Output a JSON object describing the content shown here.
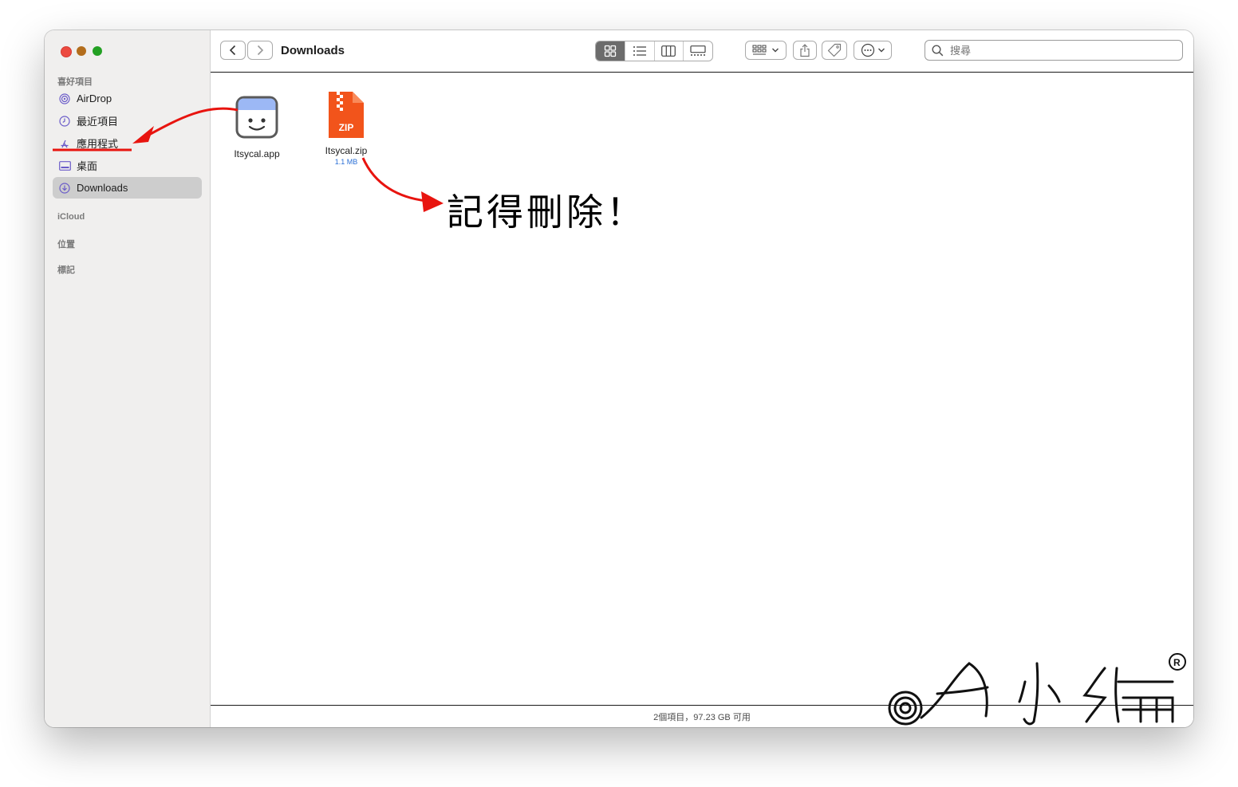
{
  "window": {
    "title": "Downloads"
  },
  "sidebar": {
    "favorites_header": "喜好項目",
    "items": [
      {
        "label": "AirDrop",
        "icon": "airdrop-icon"
      },
      {
        "label": "最近項目",
        "icon": "clock-icon"
      },
      {
        "label": "應用程式",
        "icon": "applications-icon"
      },
      {
        "label": "桌面",
        "icon": "desktop-icon"
      },
      {
        "label": "Downloads",
        "icon": "downloads-icon",
        "selected": true
      }
    ],
    "icloud_header": "iCloud",
    "locations_header": "位置",
    "tags_header": "標記"
  },
  "toolbar": {
    "search_placeholder": "搜尋",
    "view_modes": [
      "icon",
      "list",
      "column",
      "gallery"
    ],
    "active_view": "icon"
  },
  "files": [
    {
      "name": "Itsycal.app",
      "icon": "itsycal-app-icon"
    },
    {
      "name": "Itsycal.zip",
      "size": "1.1 MB",
      "icon": "zip-archive-icon",
      "badge": "ZIP"
    }
  ],
  "status": {
    "text": "2個項目，97.23 GB 可用"
  },
  "annotation": {
    "text": "記得刪除！",
    "color": "#e8140f"
  },
  "watermark": {
    "text": "A小編"
  },
  "colors": {
    "selected_sidebar": "#cdcdcd",
    "accent_red": "#e8140f",
    "zip_orange": "#f2541b"
  }
}
